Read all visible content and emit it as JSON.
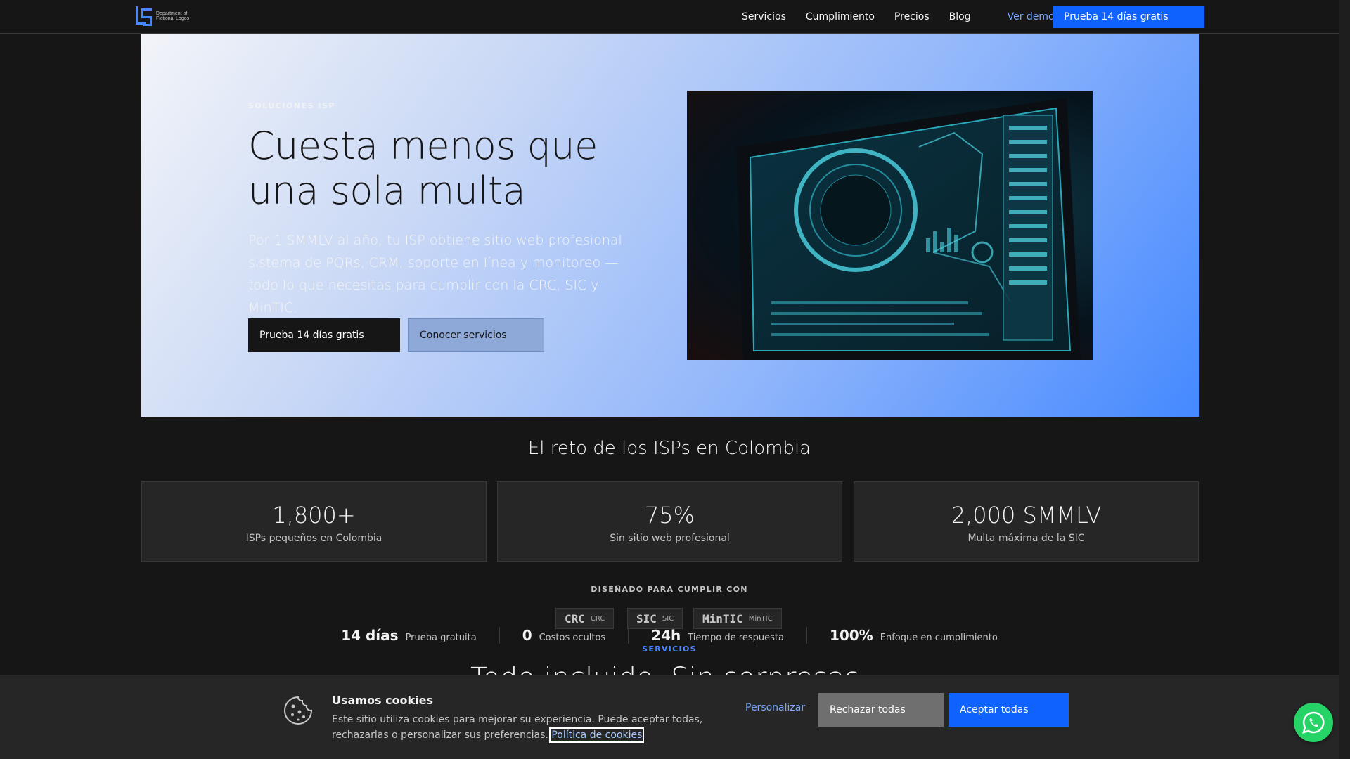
{
  "header": {
    "logo_text": "Department of Fictional Logos",
    "nav": [
      "Servicios",
      "Cumplimiento",
      "Precios",
      "Blog"
    ],
    "demo_label": "Ver demo",
    "cta_label": "Prueba 14 días gratis"
  },
  "hero": {
    "eyebrow": "SOLUCIONES ISP",
    "title": "Cuesta menos que una sola multa",
    "description": "Por 1 SMMLV al año, tu ISP obtiene sitio web profesional, sistema de PQRs, CRM, soporte en línea y monitoreo — todo lo que necesitas para cumplir con la CRC, SIC y MinTIC.",
    "primary_cta": "Prueba 14 días gratis",
    "secondary_cta": "Conocer servicios"
  },
  "challenge": {
    "title": "El reto de los ISPs en Colombia",
    "stats": [
      {
        "value": "1,800+",
        "label": "ISPs pequeños en Colombia"
      },
      {
        "value": "75%",
        "label": "Sin sitio web profesional"
      },
      {
        "value": "2,000 SMMLV",
        "label": "Multa máxima de la SIC"
      }
    ]
  },
  "compliance": {
    "label": "DISEÑADO PARA CUMPLIR CON",
    "badges": [
      {
        "big": "CRC",
        "small": "CRC"
      },
      {
        "big": "SIC",
        "small": "SIC"
      },
      {
        "big": "MinTIC",
        "small": "MinTIC"
      }
    ]
  },
  "metrics": [
    {
      "value": "14 días",
      "text": "Prueba gratuita"
    },
    {
      "value": "0",
      "text": "Costos ocultos"
    },
    {
      "value": "24h",
      "text": "Tiempo de respuesta"
    },
    {
      "value": "100%",
      "text": "Enfoque en cumplimiento"
    }
  ],
  "services": {
    "label": "SERVICIOS",
    "title": "Todo incluido. Sin sorpresas."
  },
  "cookie": {
    "title": "Usamos cookies",
    "text": "Este sitio utiliza cookies para mejorar su experiencia. Puede aceptar todas, rechazarlas o personalizar sus preferencias.",
    "link": "Política de cookies",
    "customize": "Personalizar",
    "reject": "Rechazar todas",
    "accept": "Aceptar todas"
  },
  "colors": {
    "accent": "#0f62fe",
    "link": "#78a9ff",
    "whatsapp": "#25d366"
  },
  "icons": [
    "cookie-icon",
    "whatsapp-icon",
    "logo-icon"
  ]
}
